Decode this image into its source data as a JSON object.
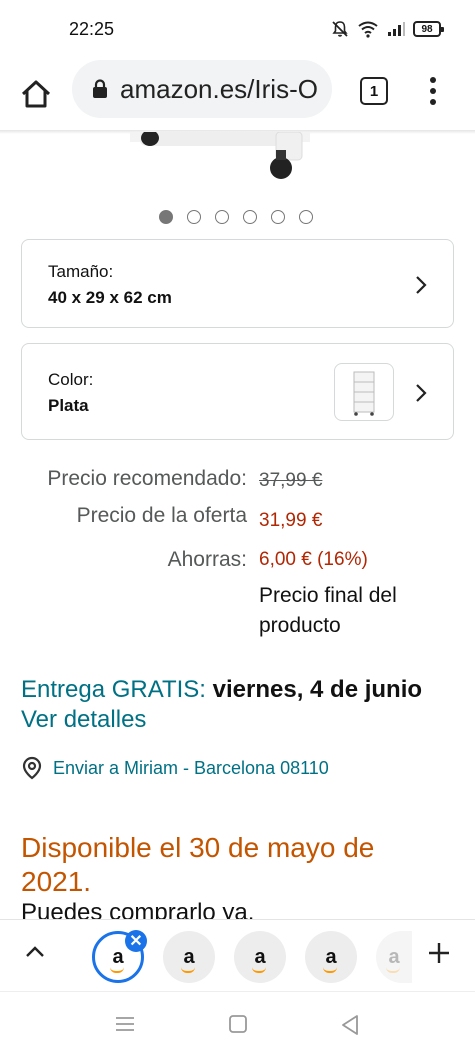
{
  "status_bar": {
    "time": "22:25",
    "battery": "98",
    "icons": [
      "mute-icon",
      "wifi-icon",
      "signal-icon",
      "battery-icon"
    ]
  },
  "browser": {
    "url": "amazon.es/Iris-O",
    "tab_count": "1",
    "icons": [
      "home-icon",
      "lock-icon",
      "menu-icon"
    ]
  },
  "carousel": {
    "total": 6,
    "active_index": 0
  },
  "options": {
    "size": {
      "label": "Tamaño:",
      "value": "40 x 29 x 62 cm"
    },
    "color": {
      "label": "Color:",
      "value": "Plata"
    }
  },
  "price": {
    "recommended_label": "Precio recomendado:",
    "recommended_value": "37,99 €",
    "offer_label": "Precio de la oferta",
    "offer_value": "31,99 €",
    "savings_label": "Ahorras:",
    "savings_value": "6,00 € (16%)",
    "note": "Precio final del producto"
  },
  "delivery": {
    "prefix": "Entrega GRATIS:",
    "date": "viernes, 4 de junio",
    "link": "Ver detalles",
    "ship_to": "Enviar a Miriam - Barcelona 08110"
  },
  "availability": {
    "title": "Disponible el 30 de mayo de 2021.",
    "sub": "Puedes comprarlo ya."
  },
  "tabs": {
    "thumb_letter": "a",
    "close_symbol": "✕"
  },
  "colors": {
    "link": "#007185",
    "price_red": "#b12704",
    "availability_orange": "#c45500",
    "tab_selected": "#1a73e8"
  }
}
